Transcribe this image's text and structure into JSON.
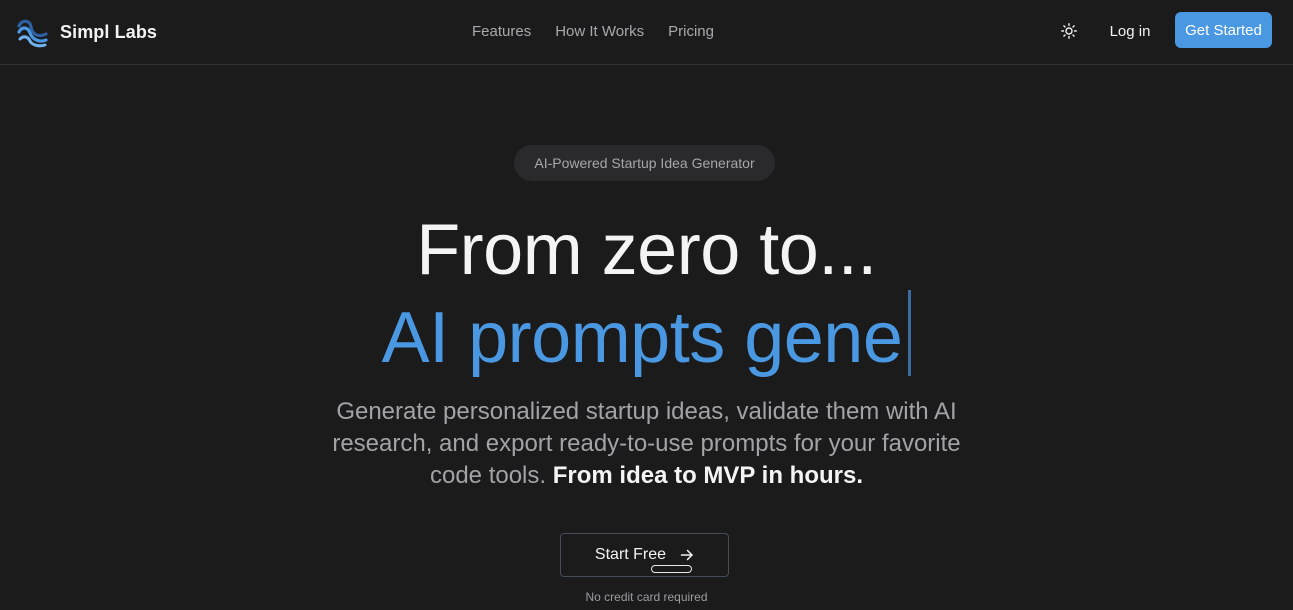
{
  "brand": {
    "name": "Simpl Labs"
  },
  "nav": {
    "items": [
      "Features",
      "How It Works",
      "Pricing"
    ]
  },
  "header": {
    "theme_icon": "sun-icon",
    "login_label": "Log in",
    "cta_label": "Get Started"
  },
  "hero": {
    "badge": "AI-Powered Startup Idea Generator",
    "headline_line1": "From zero to...",
    "headline_line2_typed": "AI prompts gene",
    "subtitle": "Generate personalized startup ideas, validate them with AI research, and export ready-to-use prompts for your favorite code tools. ",
    "subtitle_emphasis": "From idea to MVP in hours.",
    "cta_label": "Start Free",
    "cta_icon": "arrow-right-icon",
    "cta_note": "No credit card required"
  },
  "colors": {
    "background": "#1b1b1c",
    "accent": "#4a97e2",
    "text": "#f2f2f2",
    "muted": "#a3a3a6"
  }
}
